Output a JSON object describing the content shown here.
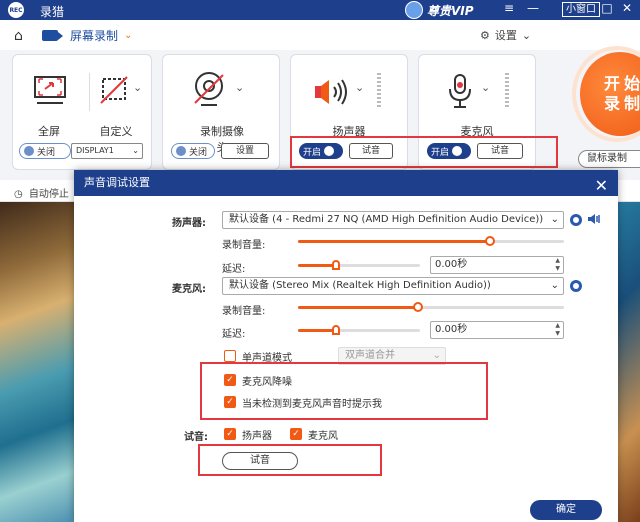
{
  "app": {
    "title": "录猎",
    "logo_text": "REC",
    "vip_label": "尊贵VIP",
    "mini_window_label": "小窗口",
    "window_controls": [
      "≡",
      "—",
      "□",
      "✕"
    ]
  },
  "toolbar": {
    "mode_label": "屏幕录制",
    "settings_label": "设置"
  },
  "cards": {
    "fullscreen_label": "全屏",
    "custom_label": "自定义",
    "display_toggle": "关闭",
    "display_select": "DISPLAY1",
    "camera_label": "录制摄像头",
    "camera_toggle": "关闭",
    "camera_settings": "设置",
    "speaker_label": "扬声器",
    "speaker_toggle": "开启",
    "speaker_test": "试音",
    "mic_label": "麦克风",
    "mic_toggle": "开启",
    "mic_test": "试音"
  },
  "start_button": {
    "line1": "开始",
    "line2": "录制"
  },
  "mouse_record": "鼠标录制",
  "auto_stop": "自动停止",
  "dialog": {
    "title": "声音调试设置",
    "speaker_label": "扬声器:",
    "speaker_device": "默认设备 (4 - Redmi 27 NQ (AMD High Definition Audio Device))",
    "speaker_volume_label": "录制音量:",
    "speaker_volume": 0.72,
    "speaker_delay_label": "延迟:",
    "speaker_delay": 0.32,
    "speaker_delay_value": "0.00秒",
    "mic_label": "麦克风:",
    "mic_device": "默认设备 (Stereo Mix (Realtek High Definition Audio))",
    "mic_volume_label": "录制音量:",
    "mic_volume": 0.45,
    "mic_delay_label": "延迟:",
    "mic_delay": 0.32,
    "mic_delay_value": "0.00秒",
    "mono_label": "单声道模式",
    "mono_checked": false,
    "mono_select": "双声道合并",
    "noise_reduction_label": "麦克风降噪",
    "noise_reduction_checked": true,
    "notify_label": "当未检测到麦克风声音时提示我",
    "notify_checked": true,
    "test_label": "试音:",
    "test_speaker_label": "扬声器",
    "test_mic_label": "麦克风",
    "test_button": "试音",
    "ok_button": "确定",
    "close_icon": "✕"
  },
  "colors": {
    "accent": "#f05a14",
    "header": "#1e3f8c",
    "highlight_box": "#e2383e"
  }
}
